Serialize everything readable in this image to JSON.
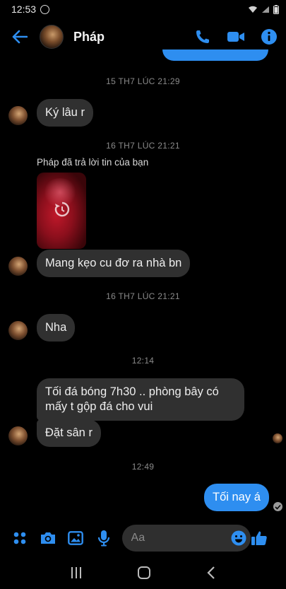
{
  "status_bar": {
    "time": "12:53"
  },
  "header": {
    "contact_name": "Pháp"
  },
  "messages": {
    "ts1": "15 TH7 LÚC 21:29",
    "m1": "Ký lâu r",
    "ts2": "16 TH7 LÚC 21:21",
    "reply_label": "Pháp đã trả lời tin của bạn",
    "m2": "Mang kẹo cu đơ ra nhà bn",
    "ts3": "16 TH7 LÚC 21:21",
    "m3": "Nha",
    "ts4": "12:14",
    "m4": "Tối đá bóng 7h30 .. phòng bây có mấy t gộp đá cho vui",
    "m5": "Đặt sân r",
    "ts5": "12:49",
    "m6": "Tối nay á"
  },
  "composer": {
    "placeholder": "Aa"
  },
  "colors": {
    "accent": "#2e8ef0",
    "incoming_bubble": "#303030",
    "background": "#000000"
  },
  "icons": [
    "back-arrow-icon",
    "phone-icon",
    "video-call-icon",
    "info-icon",
    "apps-icon",
    "camera-icon",
    "gallery-icon",
    "mic-icon",
    "emoji-icon",
    "thumbs-up-icon",
    "recents-icon",
    "home-icon",
    "nav-back-icon"
  ]
}
